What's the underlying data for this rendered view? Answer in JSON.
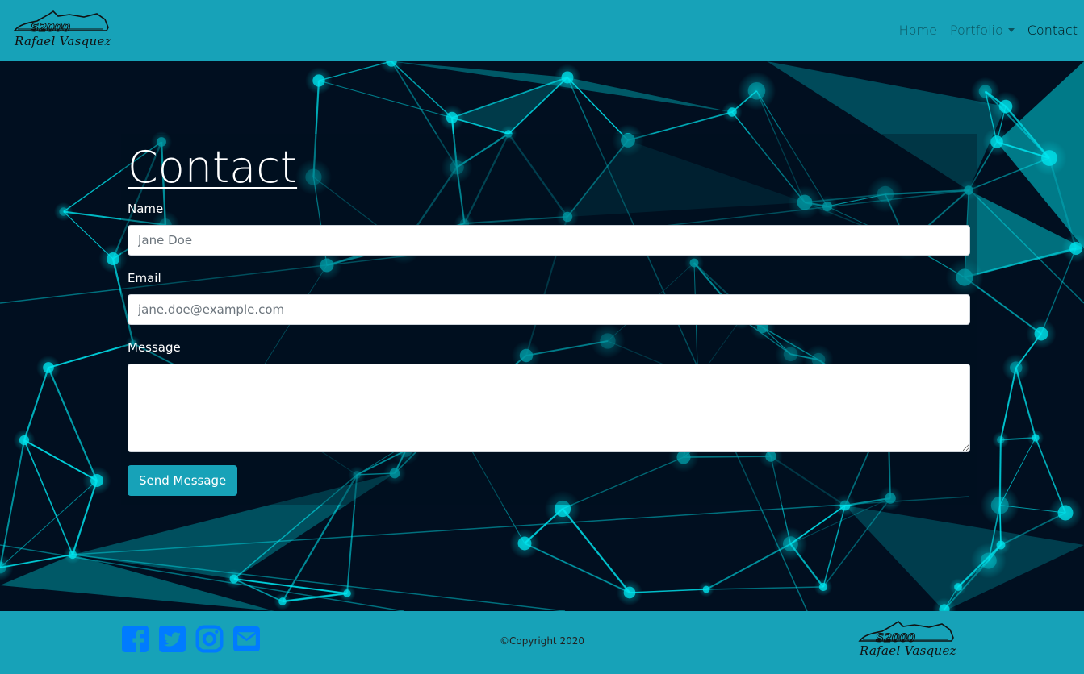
{
  "brand": {
    "model": "S2000",
    "name": "Rafael Vasquez"
  },
  "nav": {
    "home": "Home",
    "portfolio": "Portfolio",
    "contact": "Contact"
  },
  "form": {
    "title": "Contact",
    "name_label": "Name",
    "name_placeholder": "Jane Doe",
    "email_label": "Email",
    "email_placeholder": "jane.doe@example.com",
    "message_label": "Message",
    "submit_label": "Send Message"
  },
  "footer": {
    "copyright": "©Copyright 2020",
    "social_icons": [
      "facebook-icon",
      "twitter-icon",
      "instagram-icon",
      "envelope-icon"
    ]
  },
  "colors": {
    "accent": "#17a2b8",
    "background": "#001427",
    "network": "#00e5ef",
    "social": "#007bff"
  }
}
